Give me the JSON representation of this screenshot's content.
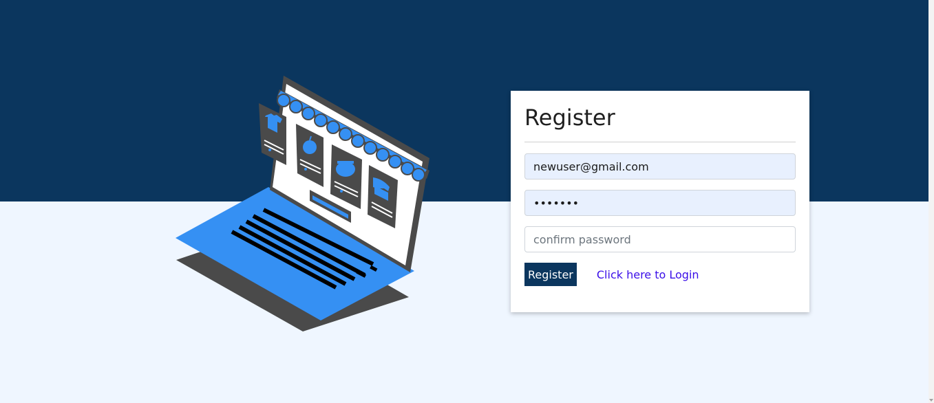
{
  "register": {
    "title": "Register",
    "email_value": "newuser@gmail.com",
    "password_value": "•••••••",
    "confirm_placeholder": "confirm password",
    "submit_label": "Register",
    "login_link_label": "Click here to Login"
  },
  "colors": {
    "hero_background": "#0b365e",
    "page_background": "#eff6ff",
    "accent_blue": "#3590f3",
    "laptop_dark": "#4a4a4a",
    "button_background": "#0b365e",
    "link_color": "#3a0ee8",
    "autofill_background": "#e8f0fe"
  },
  "illustration": {
    "subject": "laptop-storefront",
    "product_icons": [
      "shirt-icon",
      "apple-icon",
      "cooking-pot-icon",
      "telephone-icon"
    ]
  }
}
